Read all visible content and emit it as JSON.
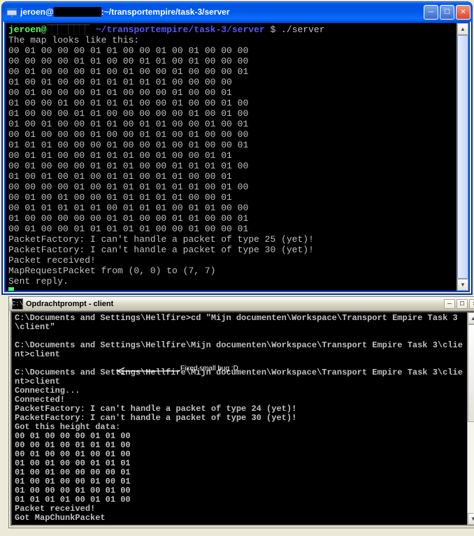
{
  "putty": {
    "title_prefix": "jeroen@",
    "title_host_hidden": "████████",
    "title_path": ":~/transportempire/task-3/server",
    "prompt_user": "jeroen@",
    "prompt_host_hidden": "████████",
    "prompt_sep1": " ",
    "prompt_path": "~/transportempire/task-3/server",
    "prompt_sep2": " $ ",
    "command": "./server",
    "intro": "The map looks like this:",
    "map_rows": [
      "00 01 00 00 00 01 01 00 00 01 00 01 00 00 00",
      "00 00 00 00 01 01 00 00 01 01 00 01 00 00 00",
      "00 01 00 00 00 01 00 01 00 00 01 00 00 00 01",
      "01 00 01 00 00 01 01 01 01 01 00 00 00 00",
      "00 01 00 00 00 01 01 00 00 00 01 00 00 01",
      "01 00 00 01 00 01 01 01 00 00 01 00 00 01 00",
      "01 00 00 00 01 01 00 00 00 00 00 01 00 01 00",
      "01 00 01 00 00 01 01 00 01 01 00 00 01 00 01",
      "00 01 00 00 00 01 00 00 01 01 00 01 00 00 00",
      "01 01 01 00 00 00 01 00 00 01 00 01 00 00 01",
      "00 01 01 00 00 01 01 01 00 01 00 00 01 01",
      "00 01 00 00 00 01 01 01 00 00 01 01 01 01 00",
      "01 00 01 00 01 00 01 01 00 01 01 00 00 01",
      "00 00 00 00 01 00 01 01 01 01 01 01 00 01 00",
      "00 01 00 01 00 00 01 01 01 01 01 00 00 01",
      "00 01 01 01 01 01 00 01 01 01 00 01 01 00 00",
      "01 00 00 00 00 00 01 01 00 00 01 01 00 00 01",
      "00 01 00 00 01 01 01 01 01 00 00 01 00 00 01"
    ],
    "msg1": "PacketFactory: I can't handle a packet of type 25 (yet)!",
    "msg2": "PacketFactory: I can't handle a packet of type 30 (yet)!",
    "msg3": "Packet received!",
    "msg4": "MapRequestPacket from (0, 0) to (7, 7)",
    "msg5": "Sent reply."
  },
  "cmd": {
    "title": "Opdrachtprompt - client",
    "line1": "C:\\Documents and Settings\\Hellfire>cd \"Mijn documenten\\Workspace\\Transport Empire Task 3\\client\"",
    "line2": "C:\\Documents and Settings\\Hellfire\\Mijn documenten\\Workspace\\Transport Empire Task 3\\client>client",
    "line3": "C:\\Documents and Settings\\Hellfire\\Mijn documenten\\Workspace\\Transport Empire Task 3\\client>client",
    "out1": "Connecting...",
    "out2": "Connected!",
    "out3": "PacketFactory: I can't handle a packet of type 24 (yet)!",
    "out4": "PacketFactory: I can't handle a packet of type 30 (yet)!",
    "out5": "Got this height data:",
    "hmap": [
      "00 01 00 00 00 01 01 00",
      "00 00 01 00 01 01 01 00",
      "00 01 00 00 01 00 01 00",
      "01 00 01 00 00 01 01 01",
      "01 00 01 00 00 00 00 01",
      "01 00 01 00 00 01 00 01",
      "01 00 00 00 01 00 01 00",
      "01 01 01 01 00 01 01 00"
    ],
    "out6": "Packet received!",
    "out7": "Got MapChunkPacket"
  },
  "annotation": {
    "text": "Fixed small bug :D"
  },
  "glyphs": {
    "min": "─",
    "max": "☐",
    "close": "✕",
    "up": "▲",
    "down": "▼"
  }
}
